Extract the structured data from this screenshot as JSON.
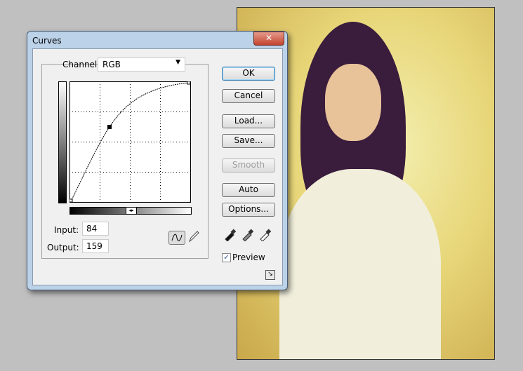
{
  "dialog": {
    "title": "Curves",
    "close": "✕"
  },
  "channel": {
    "label": "Channel:",
    "value": "RGB"
  },
  "buttons": {
    "ok": "OK",
    "cancel": "Cancel",
    "load": "Load...",
    "save": "Save...",
    "smooth": "Smooth",
    "auto": "Auto",
    "options": "Options..."
  },
  "input": {
    "label": "Input:",
    "value": "84"
  },
  "output": {
    "label": "Output:",
    "value": "159"
  },
  "preview": {
    "label": "Preview",
    "checked": true
  },
  "curve": {
    "points": [
      [
        0,
        0
      ],
      [
        84,
        159
      ],
      [
        255,
        255
      ]
    ]
  }
}
